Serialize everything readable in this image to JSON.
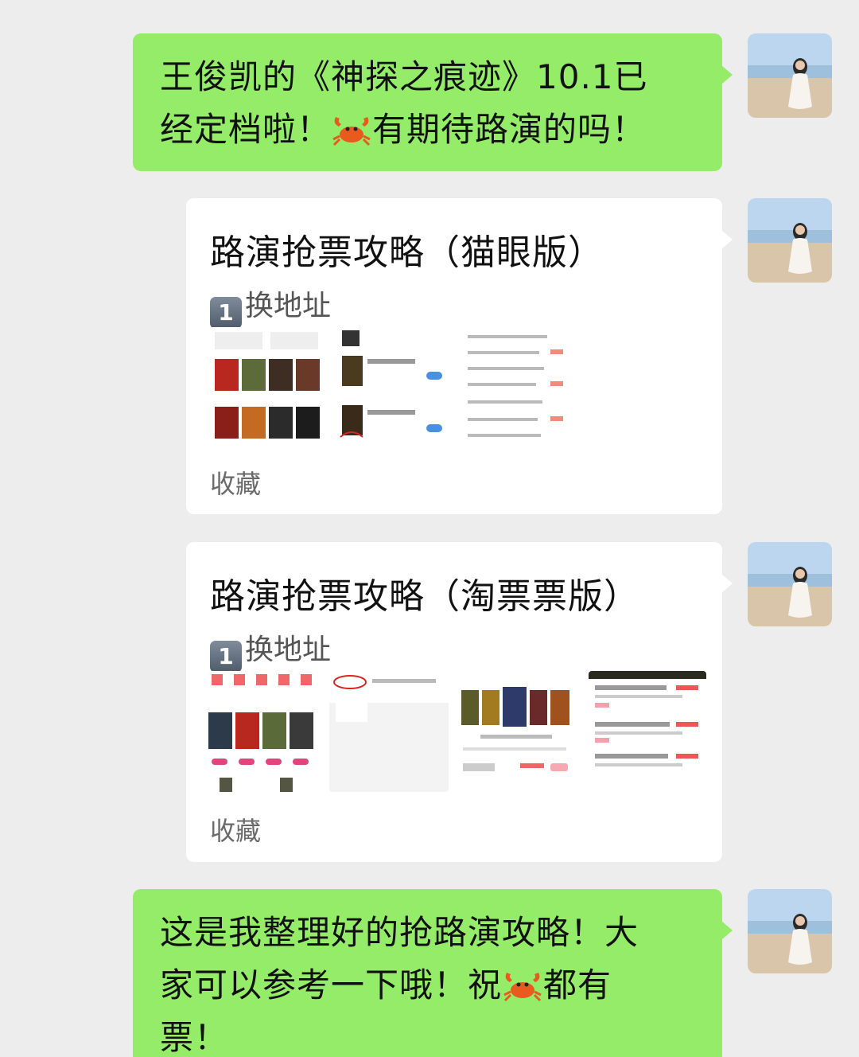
{
  "messages": [
    {
      "type": "text",
      "line1": "王俊凯的《神探之痕迹》10.1已",
      "line2_a": "经定档啦！",
      "line2_b": "有期待路演的吗！",
      "emoji": "crab"
    },
    {
      "type": "note",
      "title": "路演抢票攻略（猫眼版）",
      "sub_key": "1",
      "sub": "换地址",
      "footer": "收藏"
    },
    {
      "type": "note",
      "title": "路演抢票攻略（淘票票版）",
      "sub_key": "1",
      "sub": "换地址",
      "footer": "收藏"
    },
    {
      "type": "text",
      "line1": "这是我整理好的抢路演攻略！大",
      "line2_a": "家可以参考一下哦！祝",
      "line2_b": "都有",
      "line3": "票！",
      "emoji": "crab"
    }
  ],
  "colors": {
    "background": "#ededed",
    "sent_bubble": "#95ec69",
    "card_bubble": "#ffffff",
    "text": "#111111"
  },
  "icons": {
    "avatar": "avatar-beach-girl",
    "emoji": "crab-emoji",
    "keycap": "keycap-one"
  }
}
